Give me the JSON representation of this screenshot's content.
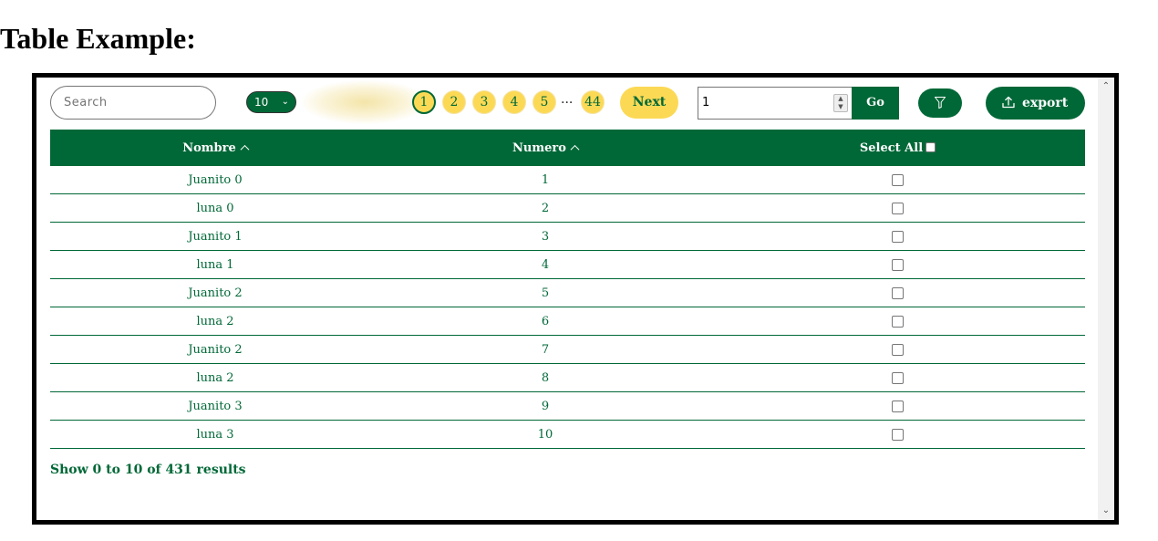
{
  "page": {
    "title": "Table Example:"
  },
  "toolbar": {
    "search_placeholder": "Search",
    "page_size": "10",
    "pages": [
      "1",
      "2",
      "3",
      "4",
      "5"
    ],
    "active_page": "1",
    "ellipsis": "...",
    "last_page": "44",
    "next_label": "Next",
    "goto_value": "1",
    "go_label": "Go",
    "filter_icon": "filter-icon",
    "export_label": "export",
    "export_icon": "upload-icon"
  },
  "table": {
    "headers": {
      "nombre": "Nombre",
      "numero": "Numero",
      "select_all": "Select All"
    },
    "rows": [
      {
        "nombre": "Juanito 0",
        "numero": "1"
      },
      {
        "nombre": "luna 0",
        "numero": "2"
      },
      {
        "nombre": "Juanito 1",
        "numero": "3"
      },
      {
        "nombre": "luna 1",
        "numero": "4"
      },
      {
        "nombre": "Juanito 2",
        "numero": "5"
      },
      {
        "nombre": "luna 2",
        "numero": "6"
      },
      {
        "nombre": "Juanito 2",
        "numero": "7"
      },
      {
        "nombre": "luna 2",
        "numero": "8"
      },
      {
        "nombre": "Juanito 3",
        "numero": "9"
      },
      {
        "nombre": "luna 3",
        "numero": "10"
      }
    ]
  },
  "footer": {
    "results_text": "Show 0 to 10 of 431 results"
  },
  "colors": {
    "primary": "#006837",
    "accent": "#fcd955",
    "frame": "#000000"
  }
}
